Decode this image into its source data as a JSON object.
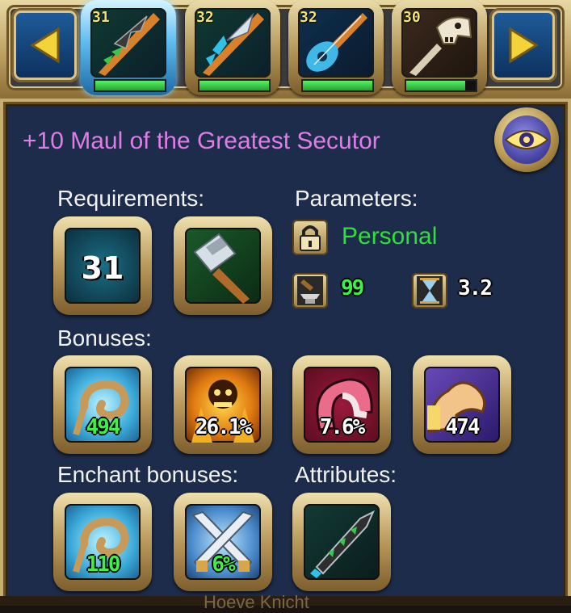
{
  "carousel": {
    "slots": [
      {
        "level": "31",
        "durability": 1.0,
        "selected": true
      },
      {
        "level": "32",
        "durability": 1.0,
        "selected": false
      },
      {
        "level": "32",
        "durability": 1.0,
        "selected": false
      },
      {
        "level": "30",
        "durability": 0.85,
        "selected": false
      }
    ],
    "prev_icon": "triangle-left-icon",
    "next_icon": "triangle-right-icon"
  },
  "item": {
    "title": "+10 Maul of the Greatest Secutor",
    "title_color": "#e07ce8",
    "view_icon": "eye-icon"
  },
  "requirements": {
    "label": "Requirements:",
    "level": "31",
    "weapon_icon": "hammer-icon"
  },
  "parameters": {
    "label": "Parameters:",
    "binding": "Personal",
    "binding_color": "#2fe03a",
    "durability": "99",
    "speed": "3.2"
  },
  "bonuses": {
    "label": "Bonuses:",
    "items": [
      {
        "value": "494",
        "icon": "whirlwind-icon",
        "color": "#3ef04a"
      },
      {
        "value": "26.1%",
        "icon": "fire-skull-icon",
        "color": "#ffffff"
      },
      {
        "value": "7.6%",
        "icon": "crescent-icon",
        "color": "#ffffff"
      },
      {
        "value": "474",
        "icon": "strength-arm-icon",
        "color": "#ffffff"
      }
    ]
  },
  "enchant_bonuses": {
    "label": "Enchant bonuses:",
    "items": [
      {
        "value": "110",
        "icon": "whirlwind-icon",
        "color": "#3ef04a"
      },
      {
        "value": "6%",
        "icon": "crossed-swords-icon",
        "color": "#3ef04a"
      }
    ]
  },
  "attributes": {
    "label": "Attributes:",
    "icon": "serrated-blade-icon"
  },
  "footer_partial_text": "Hoeve Knicht"
}
